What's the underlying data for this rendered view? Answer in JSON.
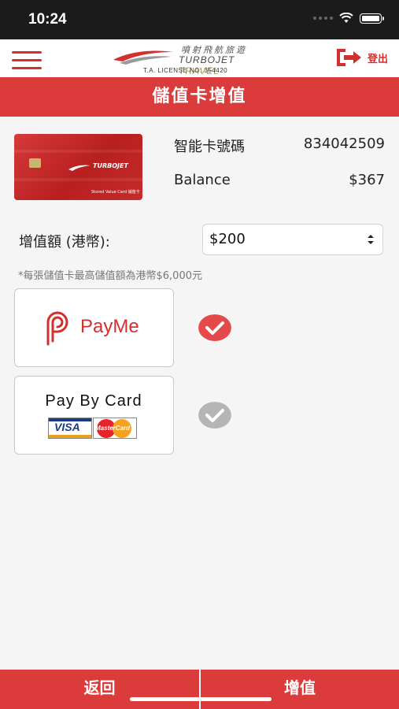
{
  "status_bar": {
    "time": "10:24"
  },
  "header": {
    "logo_zh": "噴射飛航旅遊",
    "logo_en_main": "TURBOJET",
    "logo_en_accent": "TRAVEL",
    "license": "T.A. LICENSE NO: 354420",
    "logout_label": "登出"
  },
  "page_title": "儲值卡增值",
  "card": {
    "image_brand": "TURBOJET",
    "image_caption": "Stored Value Card 儲值卡",
    "number_label": "智能卡號碼",
    "number_value": "834042509",
    "balance_label": "Balance",
    "balance_value": "$367"
  },
  "amount": {
    "label": "增值額 (港幣):",
    "selected": "$200"
  },
  "note": "*每張儲值卡最高儲值額為港幣$6,000元",
  "payment_methods": [
    {
      "label": "PayMe",
      "selected": true
    },
    {
      "label": "Pay By Card",
      "card_brands": [
        "VISA",
        "MasterCard"
      ],
      "selected": false
    }
  ],
  "footer": {
    "back_label": "返回",
    "topup_label": "增值"
  },
  "colors": {
    "brand_red": "#dc3b3b",
    "check_selected": "#e44a4a",
    "check_unselected": "#b5b5b5"
  }
}
